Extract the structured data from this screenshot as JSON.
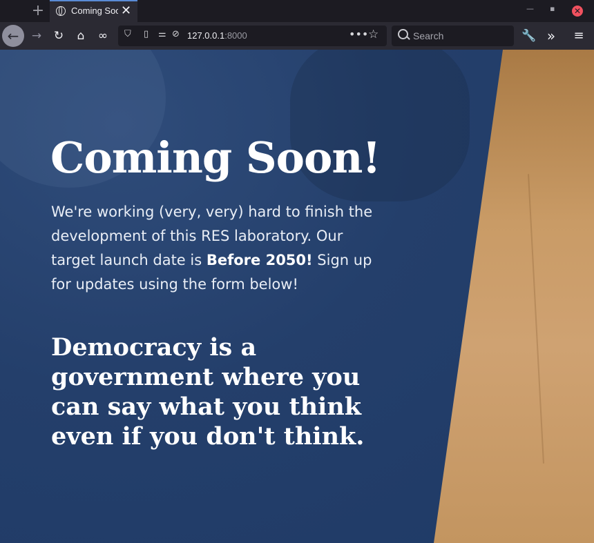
{
  "browser": {
    "tab_title": "Coming Soon",
    "url_host": "127.0.0.1",
    "url_port": ":8000",
    "search_placeholder": "Search"
  },
  "page": {
    "heading": "Coming Soon!",
    "lead_part1": "We're working (very, very) hard to finish the development of this RES laboratory. Our target launch date is ",
    "lead_bold": "Before 2050!",
    "lead_part2": " Sign up for updates using the form below!",
    "quote": "Democracy is a government where you can say what you think even if you don't think."
  },
  "colors": {
    "accent": "#5a8bd6",
    "page_blue": "#243f6b",
    "tan": "#c99b66",
    "close_red": "#f0515f"
  }
}
